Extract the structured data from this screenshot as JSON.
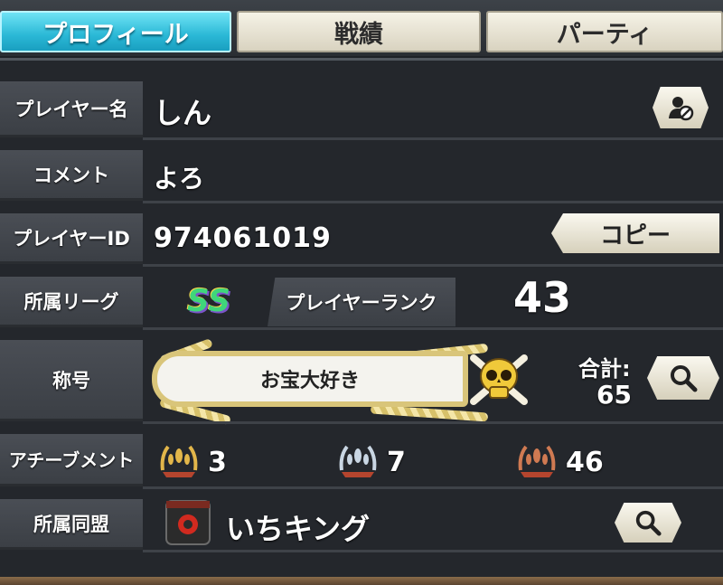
{
  "tabs": [
    {
      "label": "プロフィール",
      "active": true
    },
    {
      "label": "戦績",
      "active": false
    },
    {
      "label": "パーティ",
      "active": false
    }
  ],
  "profile": {
    "player_name_label": "プレイヤー名",
    "player_name": "しん",
    "comment_label": "コメント",
    "comment": "よろ",
    "player_id_label": "プレイヤーID",
    "player_id": "974061019",
    "copy_button": "コピー",
    "league_label": "所属リーグ",
    "league_badge": "SS",
    "rank_label": "プレイヤーランク",
    "rank": "43",
    "title_label": "称号",
    "title": "お宝大好き",
    "total_label": "合計:",
    "total": "65",
    "achievement_label": "アチーブメント",
    "achievements": [
      {
        "tier": "gold",
        "count": "3"
      },
      {
        "tier": "silver",
        "count": "7"
      },
      {
        "tier": "bronze",
        "count": "46"
      }
    ],
    "guild_label": "所属同盟",
    "guild_name": "いちキング"
  },
  "colors": {
    "active_tab": "#2ab8d6",
    "panel_bg": "#24272c",
    "label_bg": "#44484e",
    "league_badge": "#3fd67a",
    "gold": "#e2b64a",
    "silver": "#c9d6e3",
    "bronze": "#d07a52"
  },
  "icons": {
    "block_user": "block-user-icon",
    "search": "magnifier-icon",
    "skull": "skull-crossbones-icon",
    "guild_flag": "guild-flag-icon"
  }
}
